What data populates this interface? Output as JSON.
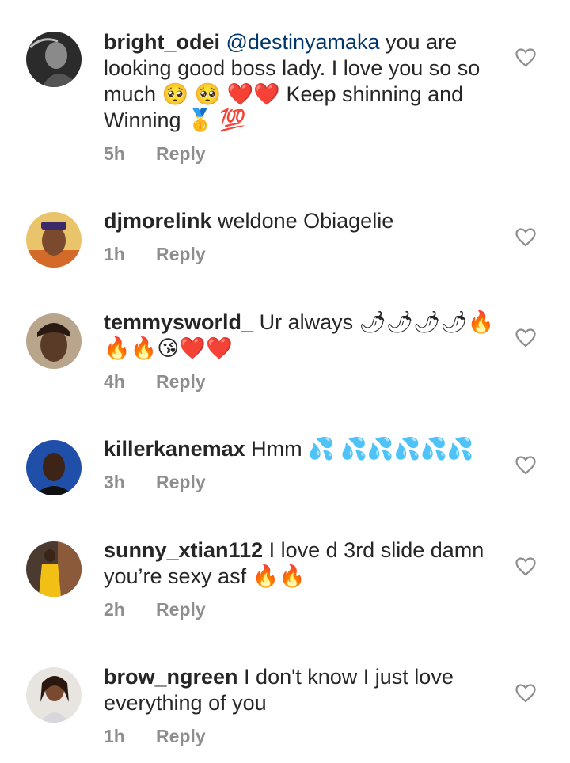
{
  "comments": [
    {
      "username": "bright_odei",
      "mention": "@destinyamaka",
      "text": "you are looking good boss lady. I love you so so much 🥺 🥺 ❤️❤️ Keep shinning and Winning 🥇 💯",
      "time": "5h",
      "reply": "Reply"
    },
    {
      "username": "djmorelink",
      "text": "weldone Obiagelie",
      "time": "1h",
      "reply": "Reply"
    },
    {
      "username": "temmysworld_",
      "text": "Ur always 🌶🌶🌶🌶🔥🔥🔥😘❤️❤️",
      "time": "4h",
      "reply": "Reply"
    },
    {
      "username": "killerkanemax",
      "text": "Hmm 💦 💦💦💦💦💦",
      "time": "3h",
      "reply": "Reply"
    },
    {
      "username": "sunny_xtian112",
      "text": "I love d 3rd slide damn you’re sexy asf 🔥🔥",
      "time": "2h",
      "reply": "Reply"
    },
    {
      "username": "brow_ngreen",
      "text": "I don't know I just love everything of you",
      "time": "1h",
      "reply": "Reply"
    }
  ],
  "icons": {
    "like": "heart-outline-icon"
  },
  "colors": {
    "text": "#262626",
    "meta": "#8e8e8e",
    "mention": "#00376b"
  }
}
